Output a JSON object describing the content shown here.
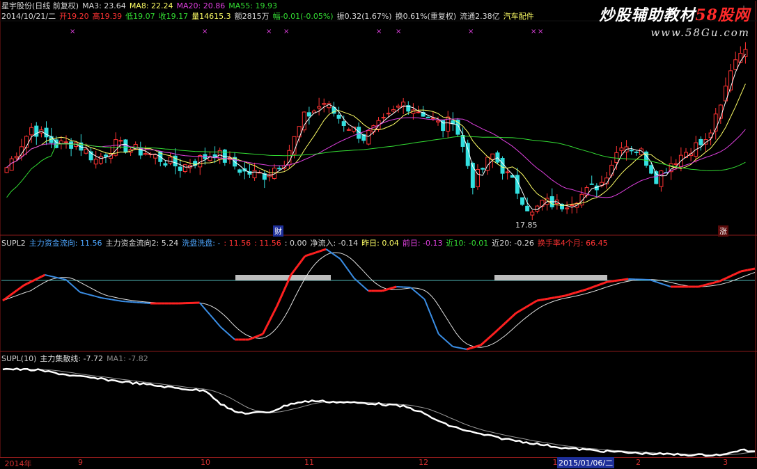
{
  "header": {
    "line1": [
      {
        "text": "星宇股份(日线 前复权)",
        "color": "#d8d8d8"
      },
      {
        "text": "MA3: 23.64",
        "color": "#d8d8d8"
      },
      {
        "text": "MA8: 22.24",
        "color": "#ffff66"
      },
      {
        "text": "MA20: 20.86",
        "color": "#e040e0"
      },
      {
        "text": "MA55: 19.93",
        "color": "#33dd33"
      }
    ],
    "line2": [
      {
        "text": "2014/10/21/二",
        "color": "#d8d8d8"
      },
      {
        "text": "开19.20",
        "color": "#ff3333"
      },
      {
        "text": "高19.39",
        "color": "#ff3333"
      },
      {
        "text": "低19.07",
        "color": "#33dd33"
      },
      {
        "text": "收19.17",
        "color": "#33dd33"
      },
      {
        "text": "量14615.3",
        "color": "#ffff66"
      },
      {
        "text": "额2815万",
        "color": "#d8d8d8"
      },
      {
        "text": "幅-0.01(-0.05%)",
        "color": "#33dd33"
      },
      {
        "text": "振0.32(1.67%)",
        "color": "#d8d8d8"
      },
      {
        "text": "换0.61%(重复权)",
        "color": "#d8d8d8"
      },
      {
        "text": "流通2.38亿",
        "color": "#d8d8d8"
      },
      {
        "text": "汽车配件",
        "color": "#ffff66"
      }
    ]
  },
  "brand": {
    "title_a": "炒股辅助教材",
    "title_b": "58股网",
    "url": "www.58Gu.com"
  },
  "main_panel": {
    "low_label": "17.85",
    "marker_cai": "财",
    "marker_zhang": "涨"
  },
  "panel2": {
    "legend": [
      {
        "text": "SUPL2",
        "color": "#d8d8d8"
      },
      {
        "text": "主力资金流向: 11.56",
        "color": "#4da6ff"
      },
      {
        "text": "主力资金流向2: 5.24",
        "color": "#d8d8d8"
      },
      {
        "text": "洗盘洗盘: -",
        "color": "#4da6ff"
      },
      {
        "text": ": 11.56",
        "color": "#ff3333"
      },
      {
        "text": ": 11.56",
        "color": "#ff3333"
      },
      {
        "text": ": 0.00",
        "color": "#d8d8d8"
      },
      {
        "text": "净流入: -0.14",
        "color": "#d8d8d8"
      },
      {
        "text": "昨日: 0.04",
        "color": "#ffff66"
      },
      {
        "text": "前日: -0.13",
        "color": "#e040e0"
      },
      {
        "text": "近10: -0.01",
        "color": "#33dd33"
      },
      {
        "text": "近20: -0.26",
        "color": "#d8d8d8"
      },
      {
        "text": "换手率4个月: 66.45",
        "color": "#ff3333"
      }
    ]
  },
  "panel3": {
    "legend": [
      {
        "text": "SUPL(10)",
        "color": "#d8d8d8"
      },
      {
        "text": "主力集散线: -7.72",
        "color": "#d8d8d8"
      },
      {
        "text": "MA1: -7.82",
        "color": "#888888"
      }
    ]
  },
  "xaxis": {
    "labels": [
      {
        "text": "2014年",
        "x": 0.006
      },
      {
        "text": "9",
        "x": 0.103
      },
      {
        "text": "10",
        "x": 0.265
      },
      {
        "text": "11",
        "x": 0.402
      },
      {
        "text": "12",
        "x": 0.553
      },
      {
        "text": "1",
        "x": 0.73
      },
      {
        "text": "2",
        "x": 0.84
      },
      {
        "text": "3",
        "x": 0.955
      }
    ],
    "selected": "2015/01/06/二"
  },
  "colors": {
    "up": "#ff3333",
    "down": "#33e0e0",
    "ma3": "#ffffff",
    "ma8": "#ffff66",
    "ma20": "#e040e0",
    "ma55": "#33dd33",
    "grid": "#8b1a1a"
  }
}
